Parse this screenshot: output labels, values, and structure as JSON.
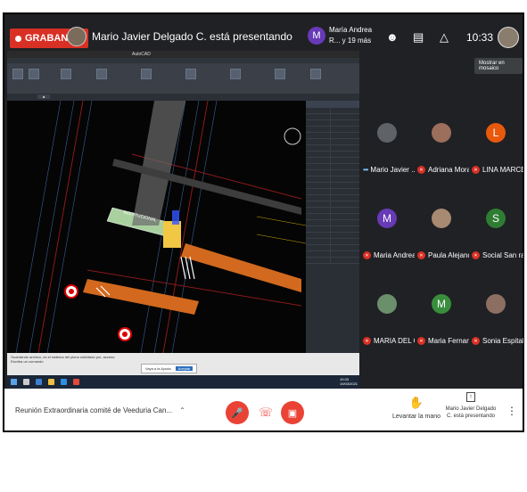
{
  "topbar": {
    "recording_label": "GRABANDO",
    "presenting_text": "Mario Javier Delgado C. está presentando",
    "others_initial": "M",
    "others_text": "María Andrea R... y 19 más",
    "clock": "10:33",
    "mosaic_button": "Mostrar en mosaico",
    "icons": [
      "people-icon",
      "chat-icon",
      "activities-icon"
    ]
  },
  "shared_screen": {
    "app_title": "AutoCAD",
    "annotation_text": "INSTITUCIONAL",
    "command_text": "Guardando archivo, es el sistema del plano solicitado por, acceso.",
    "command_prompt": "Escriba un comando",
    "notice_text": "Vaya a la Ayuda",
    "notice_button": "Aceptar",
    "taskbar_time": "10:33",
    "taskbar_date": "19/03/2021"
  },
  "participants": [
    {
      "name": "Mario Javier ...",
      "initial": "",
      "color": "#5f6368",
      "photo": true,
      "muted": false,
      "more": true
    },
    {
      "name": "Adriana Mora...",
      "initial": "",
      "color": "#9c6e5c",
      "photo": true,
      "muted": true
    },
    {
      "name": "LINA MARCE...",
      "initial": "L",
      "color": "#e8590c",
      "photo": false,
      "muted": true
    },
    {
      "name": "Maria Andrea...",
      "initial": "M",
      "color": "#673ab7",
      "photo": false,
      "muted": true
    },
    {
      "name": "Paula Alejand...",
      "initial": "",
      "color": "#a88a72",
      "photo": true,
      "muted": true
    },
    {
      "name": "Social San raf...",
      "initial": "S",
      "color": "#2e7d32",
      "photo": false,
      "muted": true
    },
    {
      "name": "MARIA DEL C...",
      "initial": "",
      "color": "#6a8f6a",
      "photo": true,
      "muted": true
    },
    {
      "name": "Maria Fernan...",
      "initial": "M",
      "color": "#388e3c",
      "photo": false,
      "muted": true
    },
    {
      "name": "Sonia Espital...",
      "initial": "",
      "color": "#8d6e63",
      "photo": true,
      "muted": true
    }
  ],
  "bottombar": {
    "meeting_name": "Reunión Extraordinaria comité de Veeduria Can...",
    "raise_hand_label": "Levantar la mano",
    "presenting_label": "Mario Javier Delgado C. está presentando",
    "colors": {
      "red": "#ea4335",
      "text": "#333333"
    }
  }
}
